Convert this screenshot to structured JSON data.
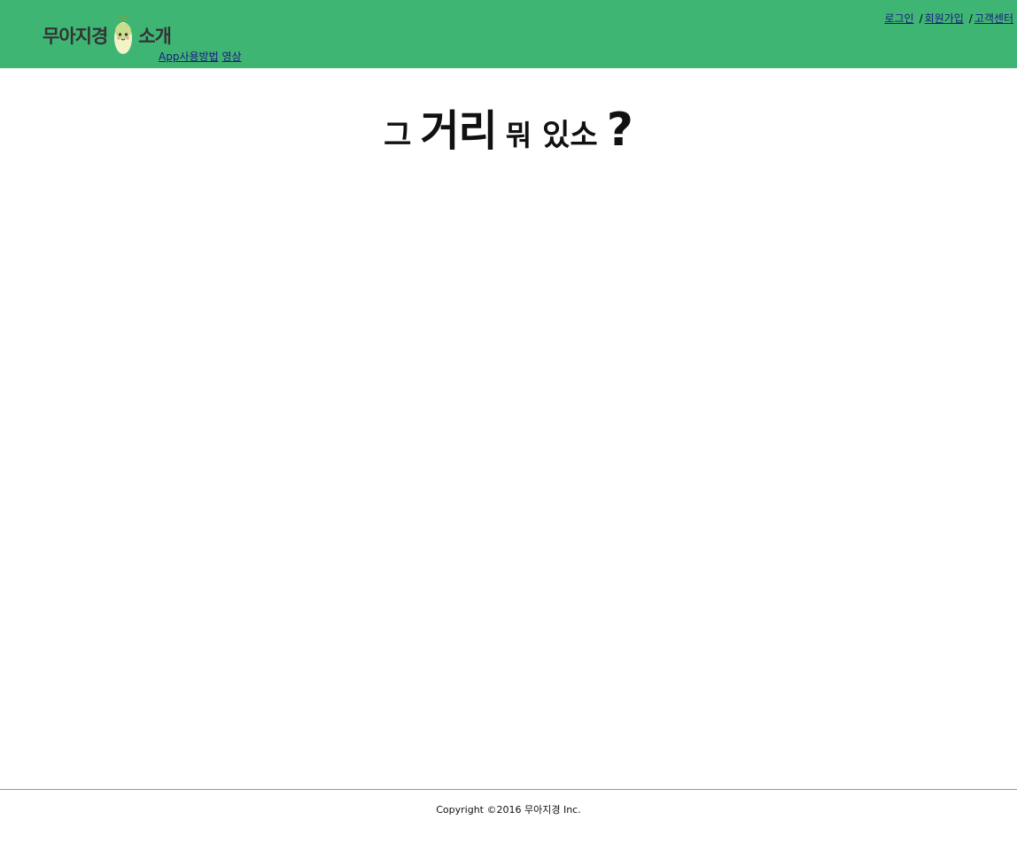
{
  "header": {
    "logo_text_left": "무아지경",
    "logo_text_right": "소개",
    "logo_icon": "radish-mascot-icon",
    "app_link": {
      "part1": "App사용방법",
      "part2": "영상"
    },
    "nav": {
      "login": "로그인",
      "separator": "/",
      "signup": "회원가입",
      "support": "고객센터"
    },
    "background_color": "#3fb573"
  },
  "hero": {
    "w1": "그",
    "w2": "거리",
    "w3": "뭐",
    "w4": "있소",
    "w5": "?"
  },
  "footer": {
    "copyright": "Copyright ©2016 무아지경 Inc."
  }
}
